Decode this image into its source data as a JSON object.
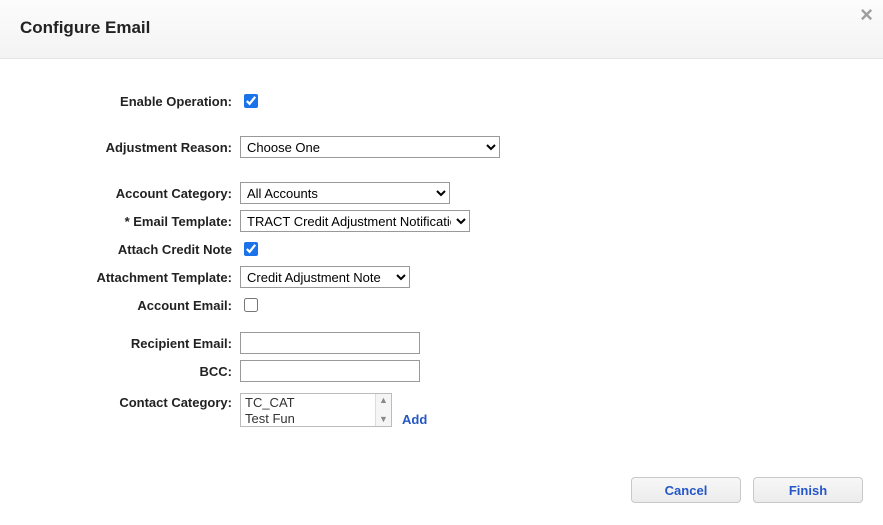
{
  "header": {
    "title": "Configure Email"
  },
  "form": {
    "enable_operation": {
      "label": "Enable Operation:",
      "checked": true
    },
    "adjustment_reason": {
      "label": "Adjustment Reason:",
      "value": "Choose One"
    },
    "account_category": {
      "label": "Account Category:",
      "value": "All Accounts"
    },
    "email_template": {
      "label": "* Email Template:",
      "value": "TRACT Credit Adjustment Notification"
    },
    "attach_credit_note": {
      "label": "Attach Credit Note",
      "checked": true
    },
    "attachment_template": {
      "label": "Attachment Template:",
      "value": "Credit Adjustment Note"
    },
    "account_email": {
      "label": "Account Email:",
      "checked": false
    },
    "recipient_email": {
      "label": "Recipient Email:",
      "value": ""
    },
    "bcc": {
      "label": "BCC:",
      "value": ""
    },
    "contact_category": {
      "label": "Contact Category:",
      "items": [
        "TC_CAT",
        "Test Fun"
      ],
      "add_label": "Add"
    }
  },
  "buttons": {
    "cancel": "Cancel",
    "finish": "Finish"
  }
}
